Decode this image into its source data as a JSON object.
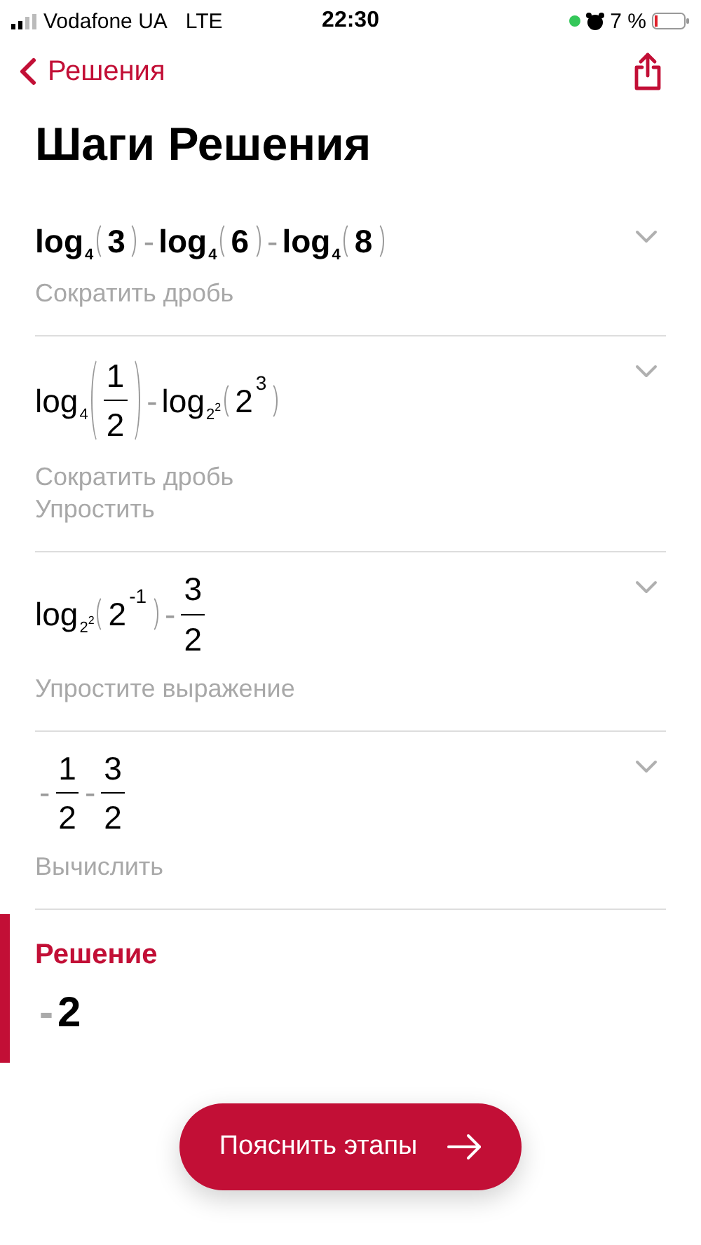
{
  "status_bar": {
    "carrier": "Vodafone UA",
    "network": "LTE",
    "time": "22:30",
    "battery": "7 %"
  },
  "nav": {
    "back_label": "Решения"
  },
  "title": "Шаги Решения",
  "steps": [
    {
      "bold": true,
      "expanded": false,
      "formula": [
        {
          "kind": "log",
          "text": "log",
          "base": "4"
        },
        {
          "kind": "paren",
          "items": [
            {
              "kind": "num",
              "text": "3"
            }
          ]
        },
        {
          "kind": "op",
          "text": "-"
        },
        {
          "kind": "log",
          "text": "log",
          "base": "4"
        },
        {
          "kind": "paren",
          "items": [
            {
              "kind": "num",
              "text": "6"
            }
          ]
        },
        {
          "kind": "op",
          "text": "-"
        },
        {
          "kind": "log",
          "text": "log",
          "base": "4"
        },
        {
          "kind": "paren",
          "items": [
            {
              "kind": "num",
              "text": "8"
            }
          ]
        }
      ],
      "notes": [
        "Сократить дробь"
      ]
    },
    {
      "bold": false,
      "expanded": false,
      "formula": [
        {
          "kind": "log",
          "text": "log",
          "base": "4"
        },
        {
          "kind": "paren",
          "items": [
            {
              "kind": "frac",
              "num": "1",
              "den": "2"
            }
          ]
        },
        {
          "kind": "op",
          "text": "-"
        },
        {
          "kind": "log",
          "text": "log",
          "base": "2$^{2}$"
        },
        {
          "kind": "paren",
          "items": [
            {
              "kind": "pow",
              "base": "2",
              "exp": "3"
            }
          ]
        }
      ],
      "notes": [
        "Сократить дробь",
        "Упростить"
      ]
    },
    {
      "bold": false,
      "expanded": false,
      "formula": [
        {
          "kind": "log",
          "text": "log",
          "base": "2$^{2}$"
        },
        {
          "kind": "paren",
          "items": [
            {
              "kind": "pow",
              "base": "2",
              "exp": "-1"
            }
          ]
        },
        {
          "kind": "op",
          "text": "-"
        },
        {
          "kind": "frac",
          "num": "3",
          "den": "2"
        }
      ],
      "notes": [
        "Упростите выражение"
      ]
    },
    {
      "bold": false,
      "expanded": false,
      "formula": [
        {
          "kind": "frac",
          "sign": "-",
          "num": "1",
          "den": "2"
        },
        {
          "kind": "op",
          "text": "-"
        },
        {
          "kind": "frac",
          "num": "3",
          "den": "2"
        }
      ],
      "notes": [
        "Вычислить"
      ]
    }
  ],
  "solution": {
    "label": "Решение",
    "value": [
      {
        "kind": "op",
        "text": "-"
      },
      {
        "kind": "num",
        "text": "2"
      }
    ]
  },
  "button": {
    "label": "Пояснить этапы"
  }
}
